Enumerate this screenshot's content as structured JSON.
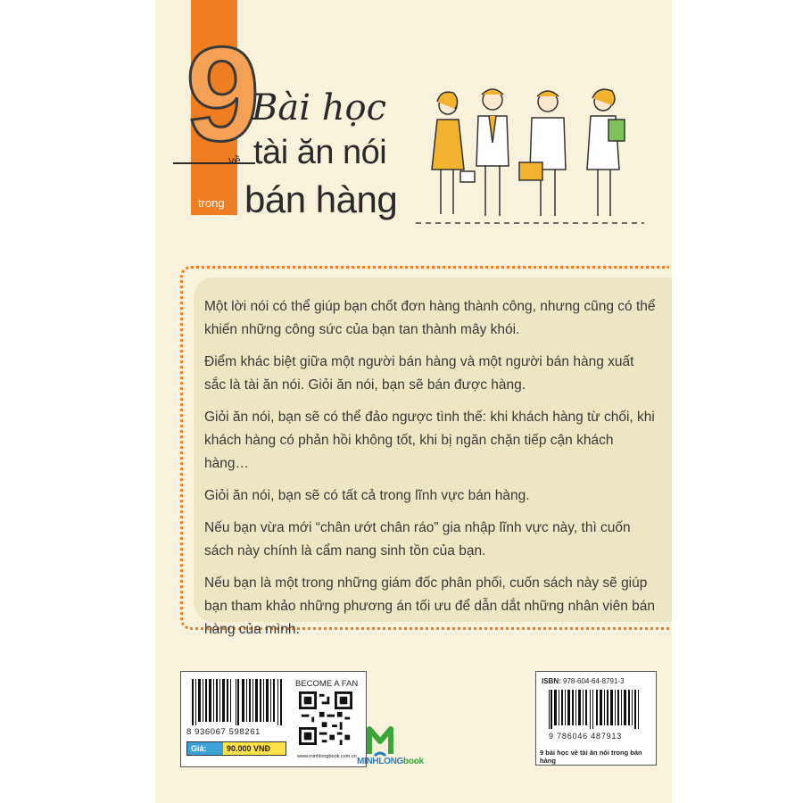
{
  "title": {
    "number": "9",
    "bai_hoc": "Bài học",
    "ve": "về",
    "line1": "tài ăn nói",
    "trong": "trong",
    "line2": "bán hàng"
  },
  "colors": {
    "accent_orange": "#ef7d22",
    "cover_bg": "#f8f2dd",
    "panel_bg": "#ece6c4"
  },
  "illustration": {
    "icon": "business-people-illustration"
  },
  "description": [
    "Một lời nói có thể giúp bạn chốt đơn hàng thành công, nhưng cũng có thể khiến những công sức của bạn tan thành mây khói.",
    "Điểm khác biệt giữa một người bán hàng và một người bán hàng xuất sắc là tài ăn nói. Giỏi ăn nói, bạn sẽ bán được hàng.",
    "Giỏi ăn nói, bạn sẽ có thể đảo ngược tình thế: khi khách hàng từ chối, khi khách hàng có phản hồi không tốt, khi bị ngăn chặn tiếp cận khách hàng…",
    "Giỏi ăn nói, bạn sẽ có tất cả trong lĩnh vực bán hàng.",
    "Nếu bạn vừa mới “chân ướt chân ráo” gia nhập lĩnh vực này, thì cuốn sách này chính là cẩm nang sinh tồn của bạn.",
    "Nếu bạn là một trong những giám đốc phân phối, cuốn sách này sẽ giúp bạn tham khảo những phương án tối ưu để dẫn dắt những nhân viên bán hàng của mình."
  ],
  "price_box": {
    "barcode_number": "8 936067 598261",
    "price_label": "Giá:",
    "price_value": "90.000 VNĐ",
    "fan_label": "BECOME A FAN",
    "website": "www.minhlongbook.com.vn"
  },
  "publisher": {
    "name_part1": "MINHLONG",
    "name_part2": "book",
    "icon": "minhlong-book-logo-icon"
  },
  "isbn_box": {
    "isbn_label": "ISBN:",
    "isbn_value": "978-604-64-8791-3",
    "barcode_number": "9 786046 487913",
    "caption": "9 bài học về tài ăn nói trong bán hàng"
  }
}
